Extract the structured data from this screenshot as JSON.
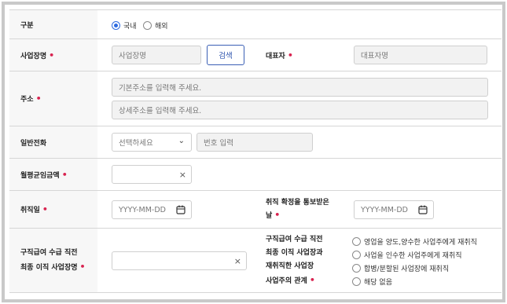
{
  "fields": {
    "type": {
      "label": "구분",
      "options": [
        "국내",
        "해외"
      ],
      "selected": "국내"
    },
    "business_name": {
      "label": "사업장명",
      "placeholder": "사업장명",
      "search_button": "검색"
    },
    "representative": {
      "label": "대표자",
      "placeholder": "대표자명"
    },
    "address": {
      "label": "주소",
      "basic_placeholder": "기본주소를 입력해 주세요.",
      "detail_placeholder": "상세주소를 입력해 주세요."
    },
    "phone": {
      "label": "일반전화",
      "select_value": "선택하세요",
      "number_placeholder": "번호 입력"
    },
    "avg_wage": {
      "label": "월평균임금액"
    },
    "hire_date": {
      "label": "취직일",
      "placeholder": "YYYY-MM-DD"
    },
    "notified_date": {
      "label_line1": "취직 확정을 통보받은",
      "label_line2": "날",
      "placeholder": "YYYY-MM-DD"
    },
    "last_employer": {
      "label_line1": "구직급여 수급 직전",
      "label_line2": "최종 이직 사업장명"
    },
    "relationship": {
      "label_line1": "구직급여 수급 직전",
      "label_line2": "최종 이직 사업장과",
      "label_line3": "재취직한 사업장",
      "label_line4": "사업주의 관계",
      "options": [
        "영업을 양도,양수한 사업주에게 재취직",
        "사업을 인수한 사업주에게 재취직",
        "합병/분할된 사업장에 재취직",
        "해당 없음"
      ]
    }
  }
}
